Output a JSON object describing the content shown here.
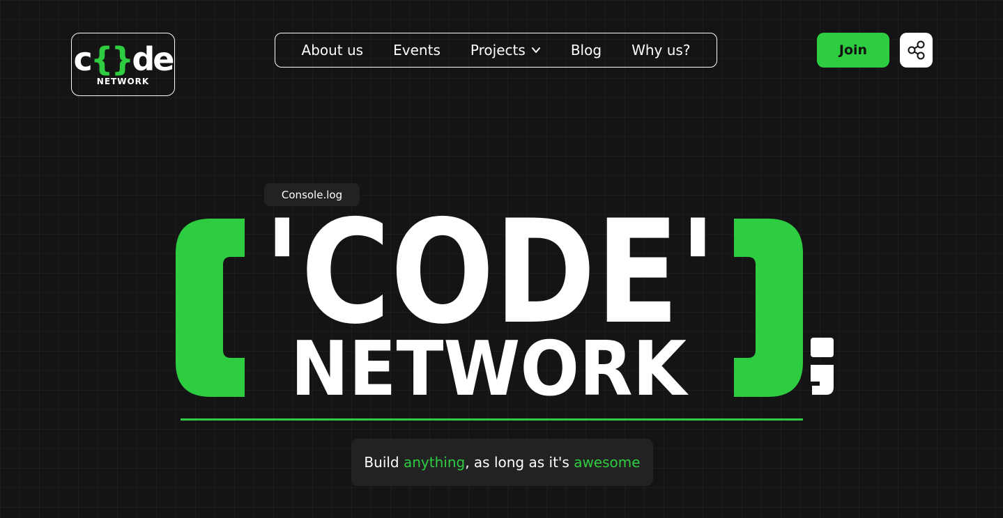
{
  "brand": {
    "logo_left": "c",
    "logo_brace": "{}",
    "logo_right": "de",
    "logo_sub": "NETWORK"
  },
  "nav": {
    "items": [
      {
        "label": "About us"
      },
      {
        "label": "Events"
      },
      {
        "label": "Projects",
        "has_dropdown": true
      },
      {
        "label": "Blog"
      },
      {
        "label": "Why us?"
      }
    ]
  },
  "actions": {
    "join_label": "Join",
    "share_icon": "share-icon"
  },
  "hero": {
    "console_label": "Console.log",
    "open_paren": "(",
    "title_line1": "'CODE'",
    "title_line2": "NETWORK",
    "close_paren": ")",
    "semicolon": ";",
    "tagline": {
      "part1": "Build ",
      "highlight1": "anything",
      "part2": ", as long as it's ",
      "highlight2": "awesome"
    }
  },
  "colors": {
    "background": "#141414",
    "accent": "#2ecc40",
    "text": "#ffffff",
    "panel": "#222222"
  }
}
